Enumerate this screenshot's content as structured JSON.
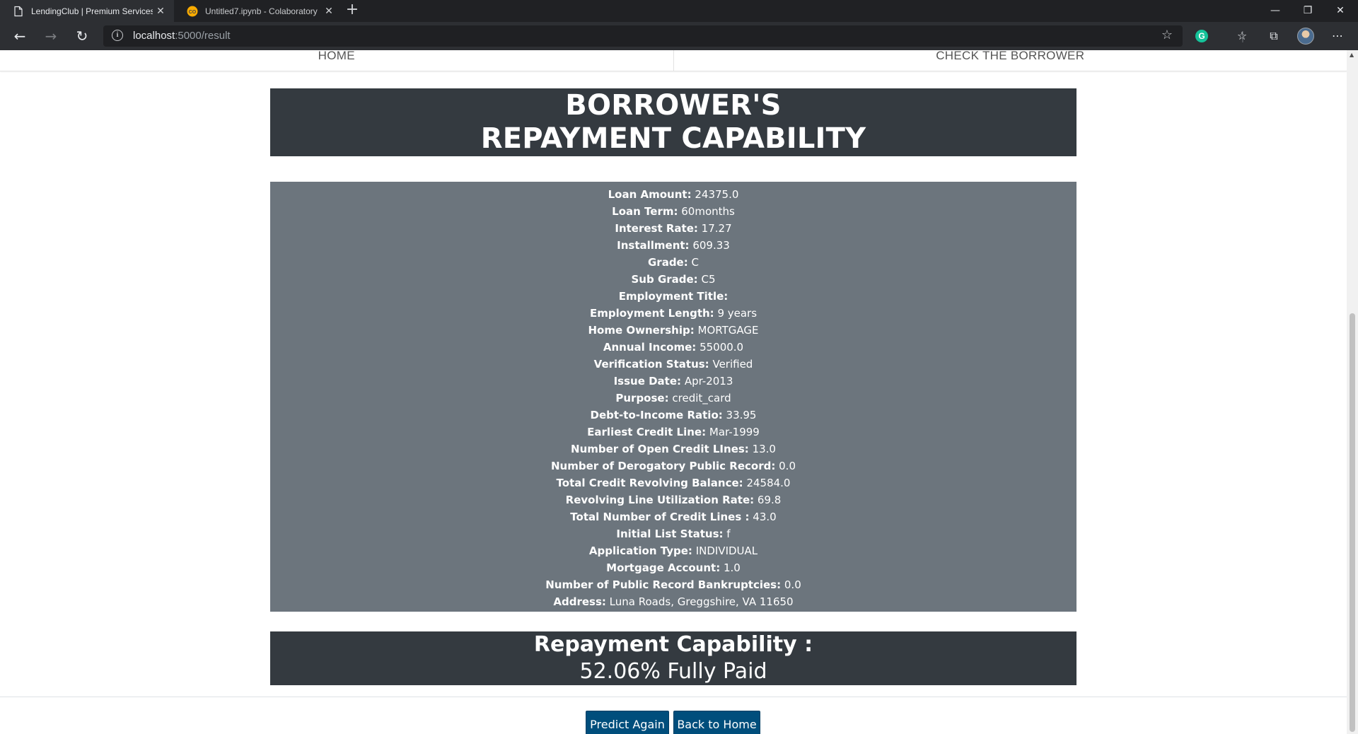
{
  "browser": {
    "tabs": [
      {
        "title": "LendingClub | Premium Services",
        "active": true
      },
      {
        "title": "Untitled7.ipynb - Colaboratory",
        "active": false
      }
    ],
    "url_host": "localhost",
    "url_path": ":5000/result",
    "accent_colors": {
      "colab": "#f9ab00",
      "grammarly": "#15c39a"
    }
  },
  "nav": {
    "home": "HOME",
    "check": "CHECK THE BORROWER"
  },
  "banner": {
    "line1": "BORROWER'S",
    "line2": "REPAYMENT CAPABILITY"
  },
  "details": [
    {
      "label": "Loan Amount:",
      "value": "24375.0"
    },
    {
      "label": "Loan Term:",
      "value": "60months"
    },
    {
      "label": "Interest Rate:",
      "value": "17.27"
    },
    {
      "label": "Installment:",
      "value": "609.33"
    },
    {
      "label": "Grade:",
      "value": "C"
    },
    {
      "label": "Sub Grade:",
      "value": "C5"
    },
    {
      "label": "Employment Title:",
      "value": ""
    },
    {
      "label": "Employment Length:",
      "value": "9 years"
    },
    {
      "label": "Home Ownership:",
      "value": "MORTGAGE"
    },
    {
      "label": "Annual Income:",
      "value": "55000.0"
    },
    {
      "label": "Verification Status:",
      "value": "Verified"
    },
    {
      "label": "Issue Date:",
      "value": "Apr-2013"
    },
    {
      "label": "Purpose:",
      "value": "credit_card"
    },
    {
      "label": "Debt-to-Income Ratio:",
      "value": "33.95"
    },
    {
      "label": "Earliest Credit Line:",
      "value": "Mar-1999"
    },
    {
      "label": "Number of Open Credit LInes:",
      "value": "13.0"
    },
    {
      "label": "Number of Derogatory Public Record:",
      "value": "0.0"
    },
    {
      "label": "Total Credit Revolving Balance:",
      "value": "24584.0"
    },
    {
      "label": "Revolving Line Utilization Rate:",
      "value": "69.8"
    },
    {
      "label": "Total Number of Credit Lines :",
      "value": "43.0"
    },
    {
      "label": "Initial List Status:",
      "value": "f"
    },
    {
      "label": "Application Type:",
      "value": "INDIVIDUAL"
    },
    {
      "label": "Mortgage Account:",
      "value": "1.0"
    },
    {
      "label": "Number of Public Record Bankruptcies:",
      "value": "0.0"
    },
    {
      "label": "Address:",
      "value": "Luna Roads, Greggshire, VA 11650"
    }
  ],
  "result": {
    "heading": "Repayment Capability :",
    "value": "52.06% Fully Paid"
  },
  "buttons": {
    "predict": "Predict Again",
    "home": "Back to Home"
  }
}
